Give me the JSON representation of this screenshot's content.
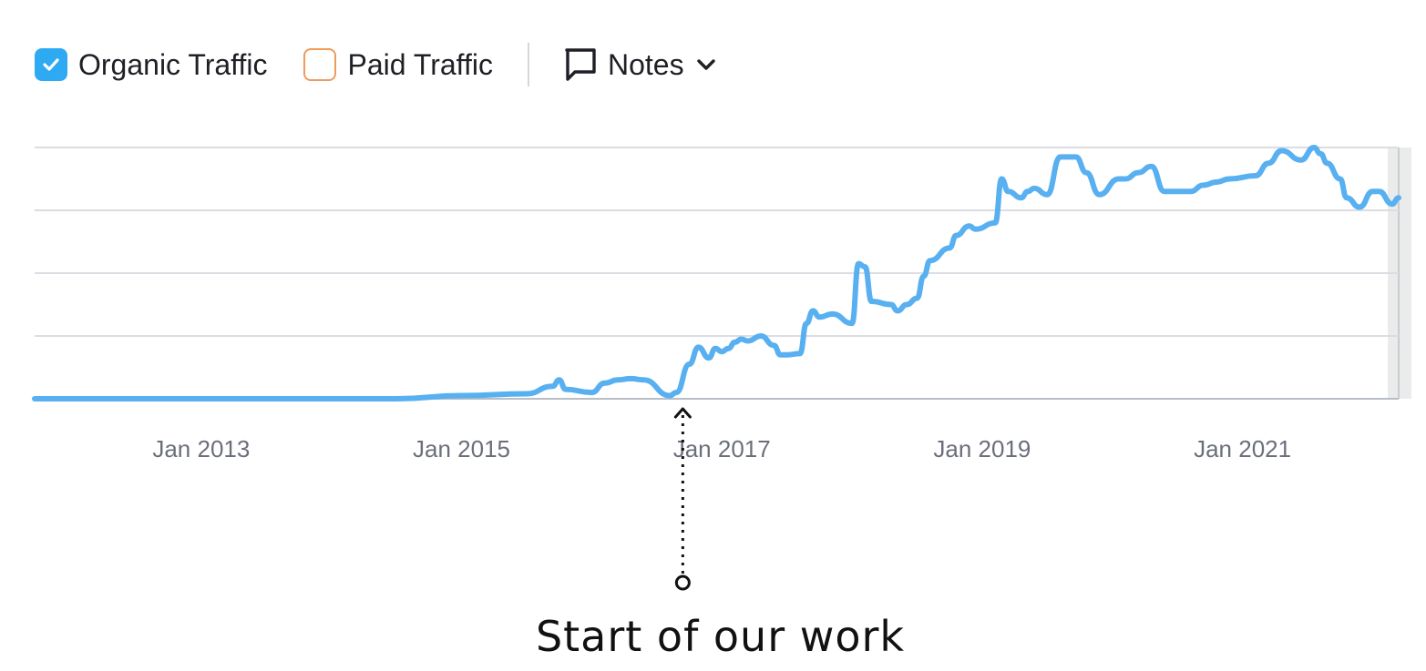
{
  "legend": {
    "organic": {
      "label": "Organic Traffic",
      "checked": true,
      "color": "#2eaaf2"
    },
    "paid": {
      "label": "Paid Traffic",
      "checked": false,
      "color": "#f09a5b"
    },
    "notes": {
      "label": "Notes",
      "icon": "comment-icon",
      "dropdown_icon": "chevron-down-icon"
    }
  },
  "annotation": {
    "label": "Start of our work",
    "date": 2016.7
  },
  "colors": {
    "line": "#58b0f0",
    "grid": "#dcdde3",
    "axis": "#b9bdc6",
    "tick_text": "#6b6f7a"
  },
  "chart_data": {
    "type": "line",
    "title": "",
    "xlabel": "",
    "ylabel": "",
    "x_tick_labels": [
      "Jan 2013",
      "Jan 2015",
      "Jan 2017",
      "Jan 2019",
      "Jan 2021"
    ],
    "x_ticks": [
      2013,
      2015,
      2017,
      2019,
      2021
    ],
    "xlim": [
      2011.72,
      2022.2
    ],
    "ylim": [
      0,
      4
    ],
    "y_gridlines": [
      1,
      2,
      3,
      4
    ],
    "grid": true,
    "legend_position": "top-left",
    "series": [
      {
        "name": "Organic Traffic",
        "x": [
          2011.72,
          2014.5,
          2015.0,
          2015.5,
          2015.7,
          2015.75,
          2015.8,
          2016.0,
          2016.1,
          2016.2,
          2016.3,
          2016.4,
          2016.6,
          2016.65,
          2016.75,
          2016.82,
          2016.9,
          2016.95,
          2017.0,
          2017.05,
          2017.1,
          2017.15,
          2017.2,
          2017.3,
          2017.4,
          2017.45,
          2017.5,
          2017.6,
          2017.65,
          2017.7,
          2017.75,
          2017.85,
          2018.0,
          2018.05,
          2018.1,
          2018.15,
          2018.3,
          2018.35,
          2018.42,
          2018.5,
          2018.55,
          2018.6,
          2018.75,
          2018.8,
          2018.9,
          2018.95,
          2019.1,
          2019.15,
          2019.2,
          2019.3,
          2019.35,
          2019.4,
          2019.5,
          2019.6,
          2019.65,
          2019.72,
          2019.8,
          2019.9,
          2020.05,
          2020.1,
          2020.2,
          2020.3,
          2020.4,
          2020.5,
          2020.6,
          2020.7,
          2020.8,
          2020.9,
          2021.1,
          2021.2,
          2021.3,
          2021.45,
          2021.55,
          2021.6,
          2021.65,
          2021.75,
          2021.8,
          2021.9,
          2022.0,
          2022.05,
          2022.15,
          2022.2
        ],
        "values": [
          0,
          0,
          0.05,
          0.08,
          0.2,
          0.3,
          0.15,
          0.1,
          0.25,
          0.3,
          0.32,
          0.3,
          0.05,
          0.1,
          0.55,
          0.82,
          0.65,
          0.8,
          0.75,
          0.8,
          0.9,
          0.95,
          0.92,
          1.0,
          0.85,
          0.7,
          0.7,
          0.72,
          1.2,
          1.4,
          1.3,
          1.35,
          1.2,
          2.15,
          2.1,
          1.55,
          1.5,
          1.4,
          1.5,
          1.6,
          1.95,
          2.2,
          2.4,
          2.6,
          2.75,
          2.7,
          2.8,
          3.5,
          3.3,
          3.2,
          3.3,
          3.35,
          3.25,
          3.85,
          3.85,
          3.85,
          3.6,
          3.25,
          3.5,
          3.5,
          3.6,
          3.7,
          3.3,
          3.3,
          3.3,
          3.4,
          3.45,
          3.5,
          3.55,
          3.75,
          3.95,
          3.8,
          4.0,
          3.9,
          3.75,
          3.5,
          3.2,
          3.05,
          3.3,
          3.3,
          3.1,
          3.2
        ]
      }
    ]
  }
}
